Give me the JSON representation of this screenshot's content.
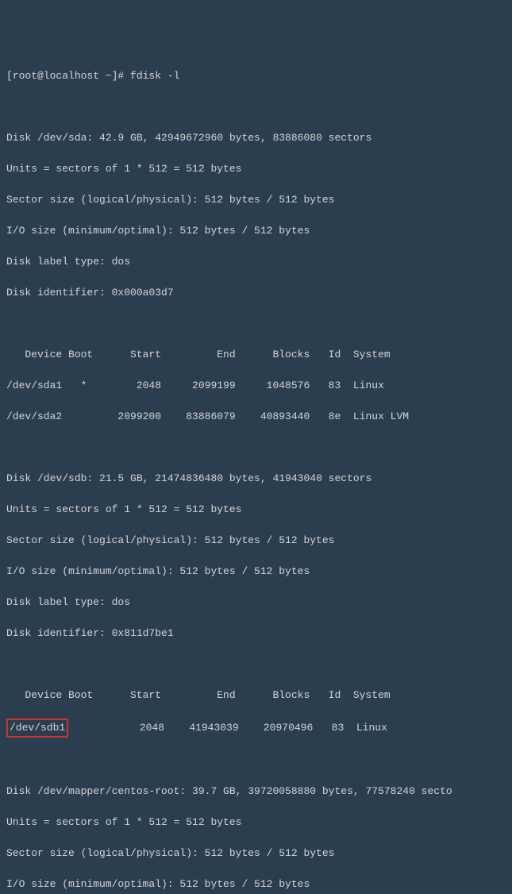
{
  "prompt": "[root@localhost ~]# fdisk -l",
  "disk_sda": {
    "header": "Disk /dev/sda: 42.9 GB, 42949672960 bytes, 83886080 sectors",
    "units": "Units = sectors of 1 * 512 = 512 bytes",
    "sector_size": "Sector size (logical/physical): 512 bytes / 512 bytes",
    "io_size": "I/O size (minimum/optimal): 512 bytes / 512 bytes",
    "label_type": "Disk label type: dos",
    "identifier": "Disk identifier: 0x000a03d7",
    "table_header": "   Device Boot      Start         End      Blocks   Id  System",
    "rows": [
      "/dev/sda1   *        2048     2099199     1048576   83  Linux",
      "/dev/sda2         2099200    83886079    40893440   8e  Linux LVM"
    ]
  },
  "disk_sdb": {
    "header": "Disk /dev/sdb: 21.5 GB, 21474836480 bytes, 41943040 sectors",
    "units": "Units = sectors of 1 * 512 = 512 bytes",
    "sector_size": "Sector size (logical/physical): 512 bytes / 512 bytes",
    "io_size": "I/O size (minimum/optimal): 512 bytes / 512 bytes",
    "label_type": "Disk label type: dos",
    "identifier": "Disk identifier: 0x811d7be1",
    "table_header": "   Device Boot      Start         End      Blocks   Id  System",
    "highlighted_device": "/dev/sdb1",
    "row_rest": "            2048    41943039    20970496   83  Linux"
  },
  "disk_mapper": {
    "header": "Disk /dev/mapper/centos-root: 39.7 GB, 39720058880 bytes, 77578240 secto",
    "units": "Units = sectors of 1 * 512 = 512 bytes",
    "sector_size": "Sector size (logical/physical): 512 bytes / 512 bytes",
    "io_size": "I/O size (minimum/optimal): 512 bytes / 512 bytes"
  }
}
